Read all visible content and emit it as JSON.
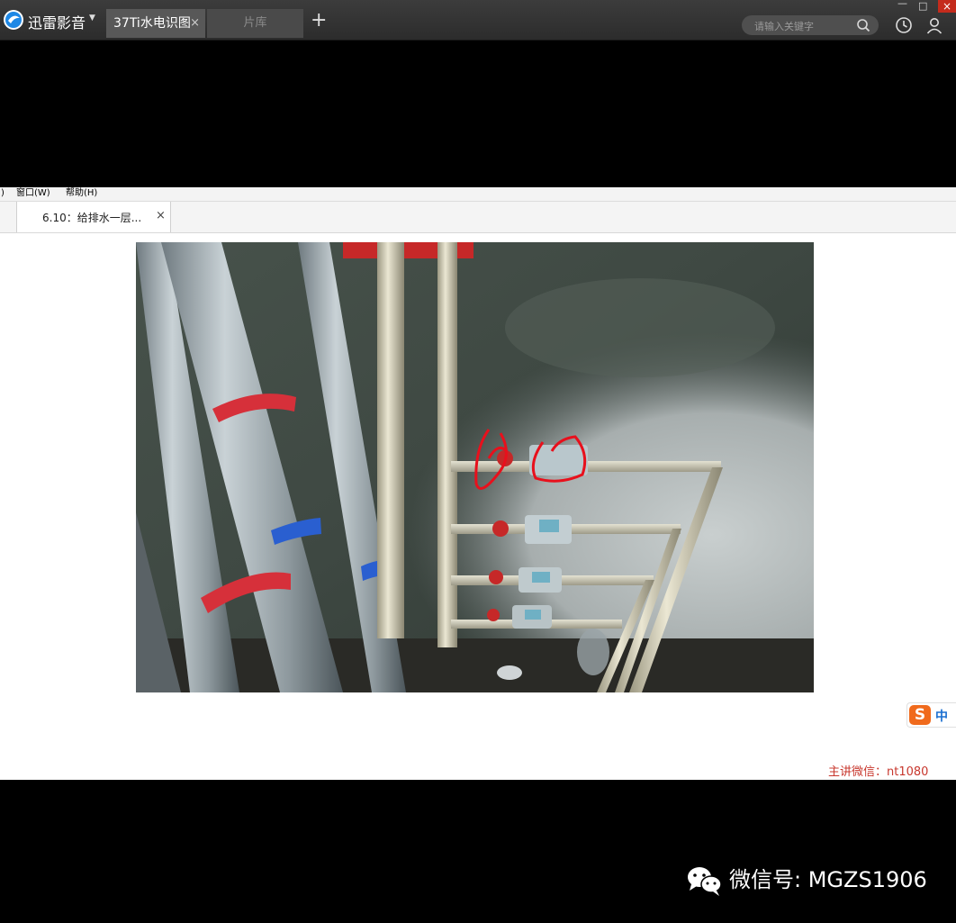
{
  "player": {
    "brand": "迅雷影音",
    "active_tab": "37Ti水电识图",
    "library_tab": "片库",
    "add_tab": "+",
    "search_placeholder": "请输入关键字",
    "close_glyph": "×"
  },
  "app": {
    "menu": [
      ")",
      "窗口(W)",
      "帮助(H)"
    ],
    "doc_tab": "6.10：给排水一层...",
    "doc_tab_close": "×",
    "ime": {
      "logo": "S",
      "mode": "中"
    },
    "lecturer_note": "主讲微信：nt1080"
  },
  "watermark": {
    "text": "微信号: MGZS1906"
  },
  "colors": {
    "titlebar": "#2c2c2c",
    "close_red": "#c42b1c",
    "accent_orange": "#f06a1c",
    "note_red": "#c8382e",
    "annotation_red": "#e8101c"
  },
  "icons": [
    "player-logo-icon",
    "search-icon",
    "history-icon",
    "user-icon",
    "minimize-icon",
    "maximize-icon",
    "close-icon",
    "wechat-icon"
  ]
}
